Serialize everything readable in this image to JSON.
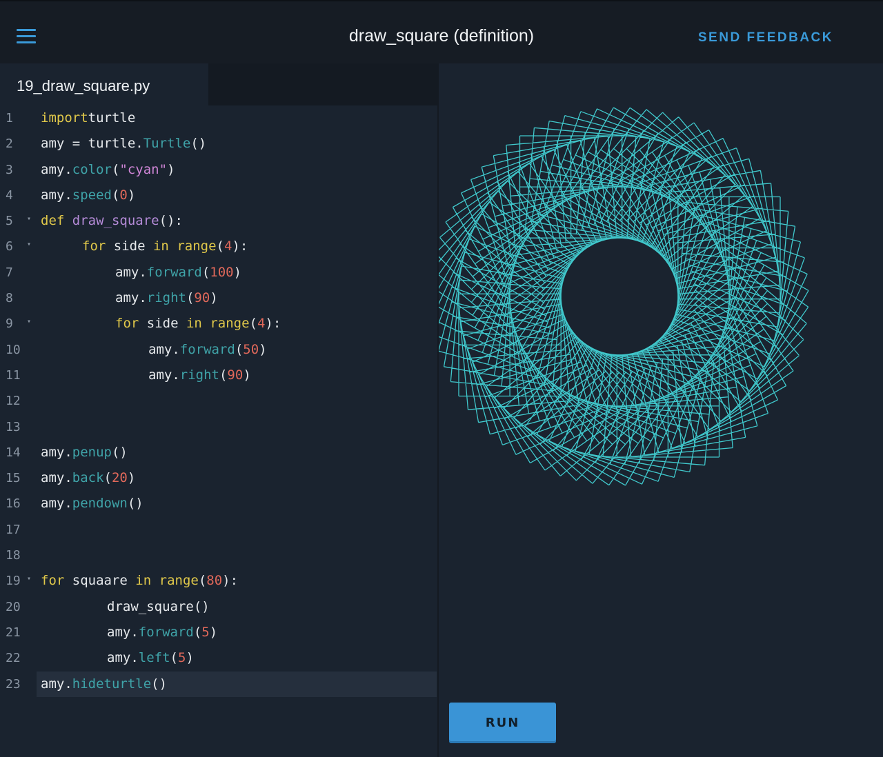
{
  "header": {
    "menu_icon": "hamburger-menu-icon",
    "title": "draw_square (definition)",
    "feedback_label": "SEND FEEDBACK",
    "accent_color": "#3a9ad9"
  },
  "editor": {
    "file_tab": "19_draw_square.py",
    "active_line": 23,
    "lines": [
      {
        "n": "1",
        "fold": false,
        "indent": 0,
        "tokens": [
          [
            "kw",
            "import"
          ],
          [
            "",
            "turtle"
          ]
        ]
      },
      {
        "n": "2",
        "fold": false,
        "indent": 0,
        "tokens": [
          [
            "",
            "amy = turtle."
          ],
          [
            "mt",
            "Turtle"
          ],
          [
            "",
            "()"
          ]
        ]
      },
      {
        "n": "3",
        "fold": false,
        "indent": 0,
        "tokens": [
          [
            "",
            "amy."
          ],
          [
            "mt",
            "color"
          ],
          [
            "",
            "("
          ],
          [
            "str",
            "\"cyan\""
          ],
          [
            "",
            ")"
          ]
        ]
      },
      {
        "n": "4",
        "fold": false,
        "indent": 0,
        "tokens": [
          [
            "",
            "amy."
          ],
          [
            "mt",
            "speed"
          ],
          [
            "",
            "("
          ],
          [
            "num",
            "0"
          ],
          [
            "",
            ")"
          ]
        ]
      },
      {
        "n": "5",
        "fold": true,
        "indent": 0,
        "tokens": [
          [
            "kw",
            "def"
          ],
          [
            "",
            " "
          ],
          [
            "fn",
            "draw_square"
          ],
          [
            "",
            "():"
          ]
        ]
      },
      {
        "n": "6",
        "fold": true,
        "indent": 60,
        "tokens": [
          [
            "kw",
            "for"
          ],
          [
            "",
            " side "
          ],
          [
            "kw",
            "in"
          ],
          [
            "",
            " "
          ],
          [
            "kw",
            "range"
          ],
          [
            "",
            "("
          ],
          [
            "num",
            "4"
          ],
          [
            "",
            "):"
          ]
        ]
      },
      {
        "n": "7",
        "fold": false,
        "indent": 108,
        "tokens": [
          [
            "",
            "amy."
          ],
          [
            "mt",
            "forward"
          ],
          [
            "",
            "("
          ],
          [
            "num",
            "100"
          ],
          [
            "",
            ")"
          ]
        ]
      },
      {
        "n": "8",
        "fold": false,
        "indent": 108,
        "tokens": [
          [
            "",
            "amy."
          ],
          [
            "mt",
            "right"
          ],
          [
            "",
            "("
          ],
          [
            "num",
            "90"
          ],
          [
            "",
            ")"
          ]
        ]
      },
      {
        "n": "9",
        "fold": true,
        "indent": 108,
        "tokens": [
          [
            "kw",
            "for"
          ],
          [
            "",
            " side "
          ],
          [
            "kw",
            "in"
          ],
          [
            "",
            " "
          ],
          [
            "kw",
            "range"
          ],
          [
            "",
            "("
          ],
          [
            "num",
            "4"
          ],
          [
            "",
            "):"
          ]
        ]
      },
      {
        "n": "10",
        "fold": false,
        "indent": 156,
        "tokens": [
          [
            "",
            "amy."
          ],
          [
            "mt",
            "forward"
          ],
          [
            "",
            "("
          ],
          [
            "num",
            "50"
          ],
          [
            "",
            ")"
          ]
        ]
      },
      {
        "n": "11",
        "fold": false,
        "indent": 156,
        "tokens": [
          [
            "",
            "amy."
          ],
          [
            "mt",
            "right"
          ],
          [
            "",
            "("
          ],
          [
            "num",
            "90"
          ],
          [
            "",
            ")"
          ]
        ]
      },
      {
        "n": "12",
        "fold": false,
        "indent": 0,
        "tokens": []
      },
      {
        "n": "13",
        "fold": false,
        "indent": 0,
        "tokens": []
      },
      {
        "n": "14",
        "fold": false,
        "indent": 0,
        "tokens": [
          [
            "",
            "amy."
          ],
          [
            "mt",
            "penup"
          ],
          [
            "",
            "()"
          ]
        ]
      },
      {
        "n": "15",
        "fold": false,
        "indent": 0,
        "tokens": [
          [
            "",
            "amy."
          ],
          [
            "mt",
            "back"
          ],
          [
            "",
            "("
          ],
          [
            "num",
            "20"
          ],
          [
            "",
            ")"
          ]
        ]
      },
      {
        "n": "16",
        "fold": false,
        "indent": 0,
        "tokens": [
          [
            "",
            "amy."
          ],
          [
            "mt",
            "pendown"
          ],
          [
            "",
            "()"
          ]
        ]
      },
      {
        "n": "17",
        "fold": false,
        "indent": 0,
        "tokens": []
      },
      {
        "n": "18",
        "fold": false,
        "indent": 0,
        "tokens": []
      },
      {
        "n": "19",
        "fold": true,
        "indent": 0,
        "tokens": [
          [
            "kw",
            "for"
          ],
          [
            "",
            " squaare "
          ],
          [
            "kw",
            "in"
          ],
          [
            "",
            " "
          ],
          [
            "kw",
            "range"
          ],
          [
            "",
            "("
          ],
          [
            "num",
            "80"
          ],
          [
            "",
            "):"
          ]
        ]
      },
      {
        "n": "20",
        "fold": false,
        "indent": 96,
        "tokens": [
          [
            "",
            "draw_square()"
          ]
        ]
      },
      {
        "n": "21",
        "fold": false,
        "indent": 96,
        "tokens": [
          [
            "",
            "amy."
          ],
          [
            "mt",
            "forward"
          ],
          [
            "",
            "("
          ],
          [
            "num",
            "5"
          ],
          [
            "",
            ")"
          ]
        ]
      },
      {
        "n": "22",
        "fold": false,
        "indent": 96,
        "tokens": [
          [
            "",
            "amy."
          ],
          [
            "mt",
            "left"
          ],
          [
            "",
            "("
          ],
          [
            "num",
            "5"
          ],
          [
            "",
            ")"
          ]
        ]
      },
      {
        "n": "23",
        "fold": false,
        "indent": 0,
        "tokens": [
          [
            "",
            "amy."
          ],
          [
            "mt",
            "hideturtle"
          ],
          [
            "",
            "()"
          ]
        ]
      }
    ]
  },
  "output": {
    "pen_color": "#40c8cc",
    "run_label": "RUN"
  }
}
